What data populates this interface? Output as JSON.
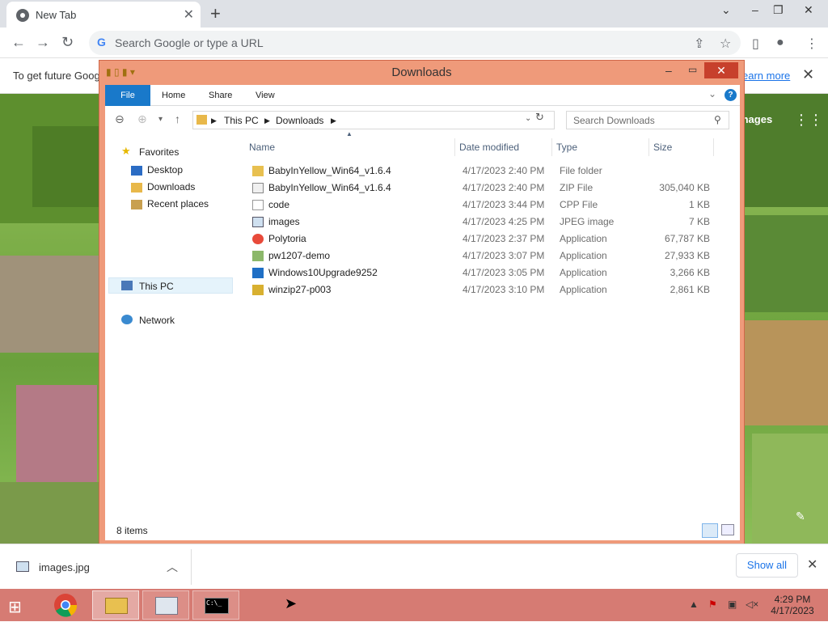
{
  "browser": {
    "tab_title": "New Tab",
    "tab_close": "✕",
    "new_tab": "+",
    "omnibox_placeholder": "Search Google or type a URL",
    "infobar_message": "To get future Goog",
    "infobar_link": "earn more",
    "infobar_close": "✕",
    "ntp_images_link": "mages",
    "window_controls": {
      "tabsearch": "⌄",
      "minimize": "–",
      "restore": "❐",
      "close": "✕"
    }
  },
  "explorer": {
    "title": "Downloads",
    "ribbon_tabs": [
      "File",
      "Home",
      "Share",
      "View"
    ],
    "breadcrumb": [
      "This PC",
      "Downloads"
    ],
    "search_placeholder": "Search Downloads",
    "nav": {
      "favorites": "Favorites",
      "desktop": "Desktop",
      "downloads": "Downloads",
      "recent": "Recent places",
      "this_pc": "This PC",
      "network": "Network"
    },
    "columns": [
      "Name",
      "Date modified",
      "Type",
      "Size"
    ],
    "files": [
      {
        "name": "BabyInYellow_Win64_v1.6.4",
        "date": "4/17/2023 2:40 PM",
        "type": "File folder",
        "size": "",
        "icon": "folder-icon"
      },
      {
        "name": "BabyInYellow_Win64_v1.6.4",
        "date": "4/17/2023 2:40 PM",
        "type": "ZIP File",
        "size": "305,040 KB",
        "icon": "zip-icon"
      },
      {
        "name": "code",
        "date": "4/17/2023 3:44 PM",
        "type": "CPP File",
        "size": "1 KB",
        "icon": "document-icon"
      },
      {
        "name": "images",
        "date": "4/17/2023 4:25 PM",
        "type": "JPEG image",
        "size": "7 KB",
        "icon": "image-icon"
      },
      {
        "name": "Polytoria",
        "date": "4/17/2023 2:37 PM",
        "type": "Application",
        "size": "67,787 KB",
        "icon": "polytoria-icon"
      },
      {
        "name": "pw1207-demo",
        "date": "4/17/2023 3:07 PM",
        "type": "Application",
        "size": "27,933 KB",
        "icon": "installer-icon"
      },
      {
        "name": "Windows10Upgrade9252",
        "date": "4/17/2023 3:05 PM",
        "type": "Application",
        "size": "3,266 KB",
        "icon": "windows-icon"
      },
      {
        "name": "winzip27-p003",
        "date": "4/17/2023 3:10 PM",
        "type": "Application",
        "size": "2,861 KB",
        "icon": "winzip-icon"
      }
    ],
    "status_count": "8 items"
  },
  "downloads_bar": {
    "file_name": "images.jpg",
    "show_all": "Show all",
    "close": "✕"
  },
  "taskbar": {
    "time": "4:29 PM",
    "date": "4/17/2023"
  }
}
